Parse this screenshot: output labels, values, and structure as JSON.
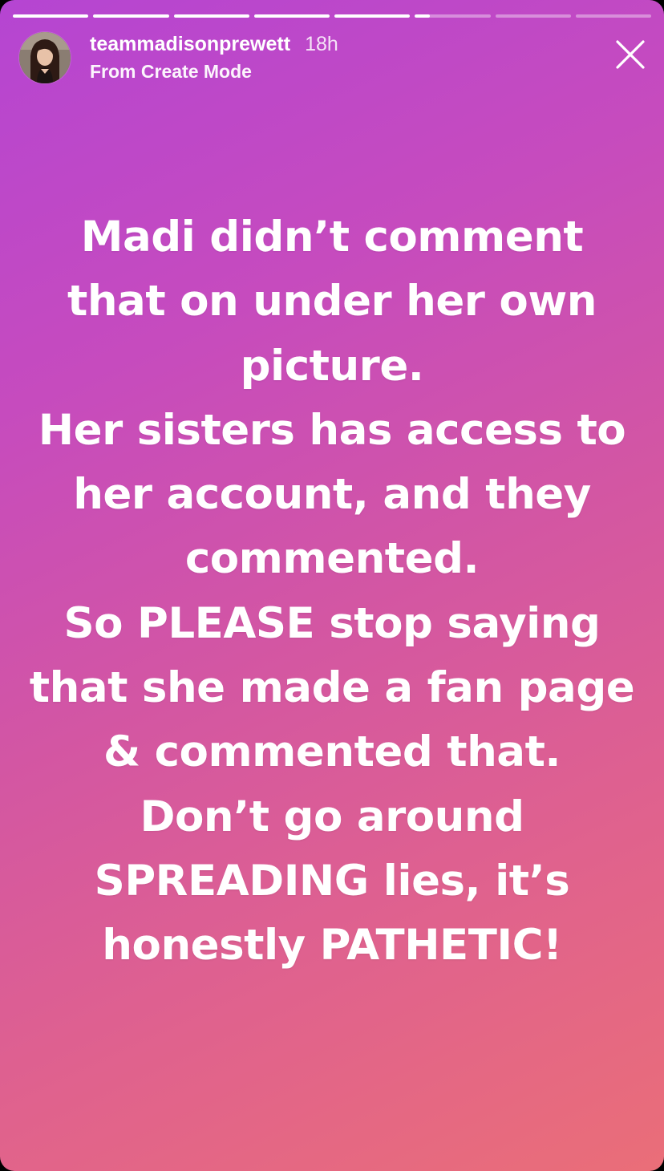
{
  "story": {
    "progress_segments": [
      1,
      1,
      1,
      1,
      1,
      0.2,
      0,
      0
    ],
    "username": "teammadisonprewett",
    "time_ago": "18h",
    "subtitle": "From Create Mode",
    "close_icon": "close-icon",
    "gradient_colors": [
      "#b545d2",
      "#d356a3",
      "#ea6e78"
    ],
    "text_lines": [
      "Madi didn’t comment",
      "that on under her own",
      "picture.",
      "Her sisters has access to",
      "her account, and they",
      "commented.",
      "So PLEASE stop saying",
      "that she made a fan page",
      "& commented that.",
      "Don’t go around",
      "SPREADING lies, it’s",
      "honestly PATHETIC!"
    ]
  }
}
